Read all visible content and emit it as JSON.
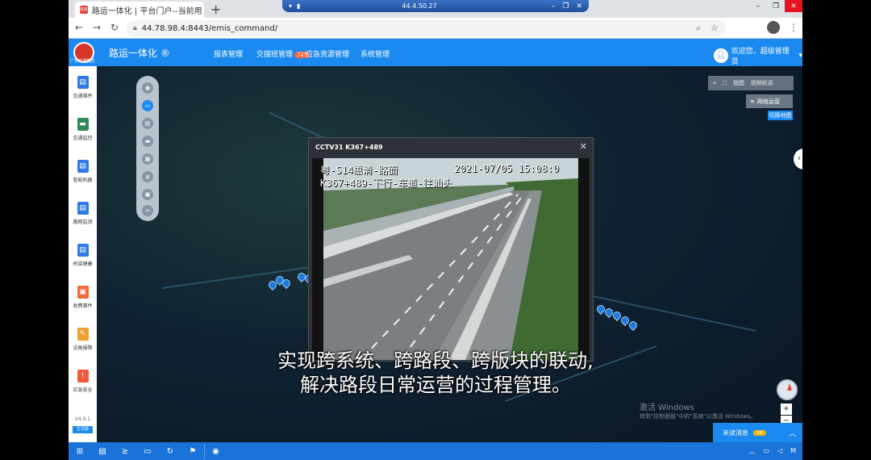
{
  "browser": {
    "tab_title": "路运一体化 | 平台门户--当前用",
    "tab_favicon_text": "RR",
    "url": "44.78.98.4:8443/emis_command/"
  },
  "remote_bar": {
    "ip": "44.4.50.27"
  },
  "app": {
    "title": "路运一体化 ®",
    "logo_text": "广东交通集团",
    "nav": [
      "报表管理",
      "交接班管理",
      "应急资源管理",
      "系统管理"
    ],
    "nav_badge": "325",
    "user_greeting": "欢迎您，超级管理员"
  },
  "sidebar": {
    "items": [
      {
        "label": "交通事件",
        "color": "#2f7ae5"
      },
      {
        "label": "交通监控",
        "color": "#2e8b57"
      },
      {
        "label": "智能机器",
        "color": "#2f7ae5"
      },
      {
        "label": "路网监测",
        "color": "#2f7ae5"
      },
      {
        "label": "桥梁健康",
        "color": "#2f7ae5"
      },
      {
        "label": "收费事件",
        "color": "#f06a3a"
      },
      {
        "label": "设备报障",
        "color": "#f0a030"
      },
      {
        "label": "应急安全",
        "color": "#f05a3a"
      }
    ],
    "version": "V4.0.1",
    "edition": "正式版"
  },
  "map": {
    "tools": [
      "指图",
      "视频轮巡"
    ],
    "road_status": "网络运营",
    "switch_map": "切换地图",
    "unread_label": "未读消息",
    "unread_count": "28",
    "activation_title": "激活 Windows",
    "activation_sub": "转到\"控制面板\"中的\"系统\"以激活 Windows。"
  },
  "video": {
    "title": "CCTV31 K367+489",
    "osd_line1_left": "粤-S14惠清-路面",
    "osd_line1_right": "2021-07/05 15:08:0",
    "osd_line2": "K367+489-下行-车道-往汕头"
  },
  "subtitle": {
    "line1": "实现跨系统、跨路段、跨版块的联动,",
    "line2": "解决路段日常运营的过程管理。"
  },
  "colors": {
    "accent": "#1a8af0",
    "map_bg": "#102232"
  }
}
